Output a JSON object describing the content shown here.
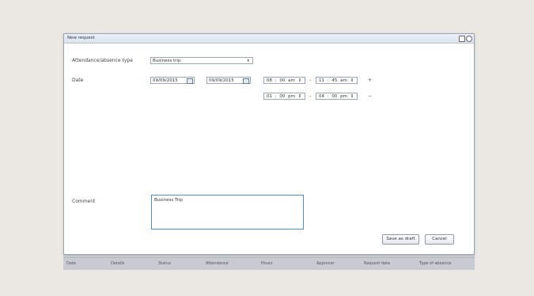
{
  "dialog": {
    "title": "New request"
  },
  "form": {
    "type_label": "Attendance/absence type",
    "type_value": "Business trip",
    "date_label": "Date",
    "date_from": "09/09/2015",
    "date_to": "09/09/2015",
    "time_rows": [
      {
        "start": "08 : 00  am",
        "end": "11 : 45  am",
        "op": "+"
      },
      {
        "start": "01 : 00  pm",
        "end": "04 : 00  pm",
        "op": "−"
      }
    ],
    "comment_label": "Comment",
    "comment_value": "Business Trip"
  },
  "buttons": {
    "save_draft": "Save as draft",
    "cancel": "Cancel"
  },
  "background_bar": [
    "Date",
    "Details",
    "Status",
    "Attendance",
    "Hours",
    "Approver",
    "Request date",
    "Type of absence"
  ]
}
